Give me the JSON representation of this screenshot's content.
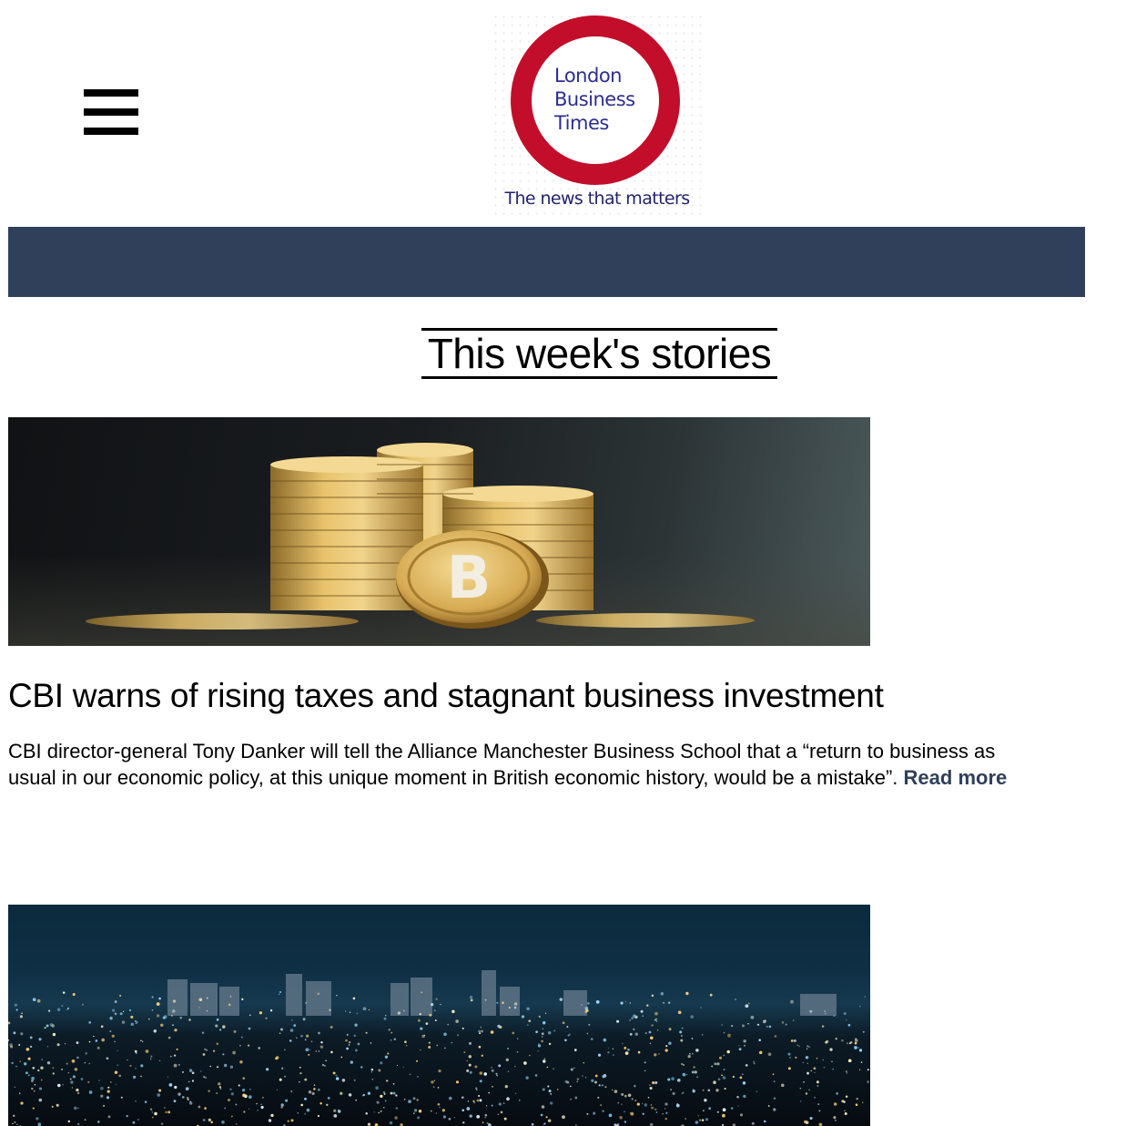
{
  "header": {
    "menu_icon": "hamburger-menu-icon",
    "logo": {
      "line1": "London",
      "line2": "Business",
      "line3": "Times",
      "tagline": "The news that matters",
      "ring_color": "#c20e2b",
      "text_color": "#2b2e8e"
    }
  },
  "navbar": {
    "color": "#30405a"
  },
  "main": {
    "section_title": "This week's stories",
    "stories": [
      {
        "image_alt": "bitcoin-coins-image",
        "title": "CBI warns of rising taxes and stagnant business investment",
        "summary": "CBI director-general Tony Danker will tell the Alliance Manchester Business School that a “return to business as usual in our economic policy, at this unique moment in British economic history, would be a mistake”.",
        "read_more": "Read more"
      },
      {
        "image_alt": "city-at-night-image"
      }
    ]
  },
  "colors": {
    "accent": "#30405a",
    "brand_red": "#c20e2b"
  }
}
